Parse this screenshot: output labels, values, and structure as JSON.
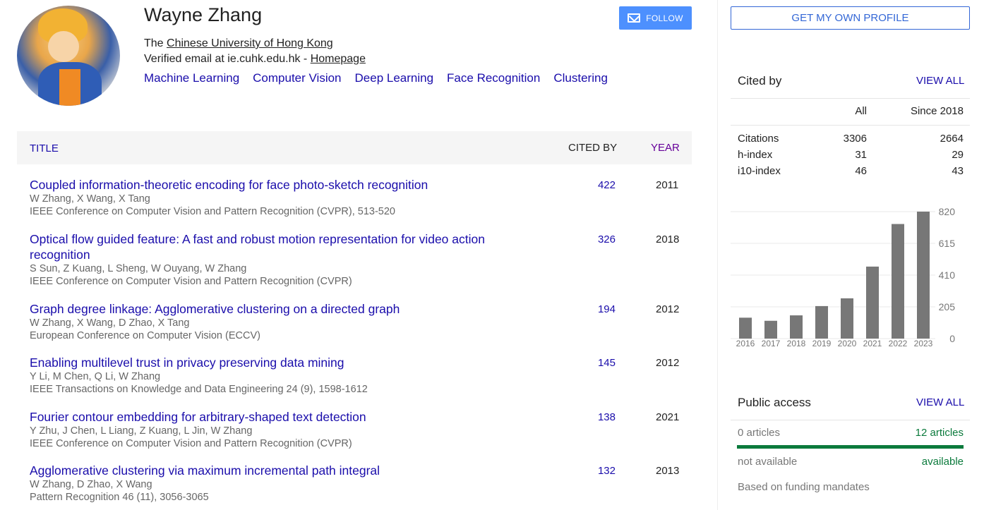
{
  "profile": {
    "name": "Wayne Zhang",
    "affil_prefix": "The ",
    "affil_link": "Chinese University of Hong Kong",
    "email_text": "Verified email at ie.cuhk.edu.hk - ",
    "homepage_link": "Homepage",
    "interests": [
      "Machine Learning",
      "Computer Vision",
      "Deep Learning",
      "Face Recognition",
      "Clustering"
    ],
    "follow_label": "FOLLOW"
  },
  "table": {
    "headers": {
      "title": "TITLE",
      "cited_by": "CITED BY",
      "year": "YEAR"
    },
    "rows": [
      {
        "title": "Coupled information-theoretic encoding for face photo-sketch recognition",
        "authors": "W Zhang, X Wang, X Tang",
        "venue": "IEEE Conference on Computer Vision and Pattern Recognition (CVPR), 513-520",
        "cites": "422",
        "year": "2011"
      },
      {
        "title": "Optical flow guided feature: A fast and robust motion representation for video action recognition",
        "authors": "S Sun, Z Kuang, L Sheng, W Ouyang, W Zhang",
        "venue": "IEEE Conference on Computer Vision and Pattern Recognition (CVPR)",
        "cites": "326",
        "year": "2018"
      },
      {
        "title": "Graph degree linkage: Agglomerative clustering on a directed graph",
        "authors": "W Zhang, X Wang, D Zhao, X Tang",
        "venue": "European Conference on Computer Vision (ECCV)",
        "cites": "194",
        "year": "2012"
      },
      {
        "title": "Enabling multilevel trust in privacy preserving data mining",
        "authors": "Y Li, M Chen, Q Li, W Zhang",
        "venue": "IEEE Transactions on Knowledge and Data Engineering 24 (9), 1598-1612",
        "cites": "145",
        "year": "2012"
      },
      {
        "title": "Fourier contour embedding for arbitrary-shaped text detection",
        "authors": "Y Zhu, J Chen, L Liang, Z Kuang, L Jin, W Zhang",
        "venue": "IEEE Conference on Computer Vision and Pattern Recognition (CVPR)",
        "cites": "138",
        "year": "2021"
      },
      {
        "title": "Agglomerative clustering via maximum incremental path integral",
        "authors": "W Zhang, D Zhao, X Wang",
        "venue": "Pattern Recognition 46 (11), 3056-3065",
        "cites": "132",
        "year": "2013"
      }
    ]
  },
  "sidebar": {
    "own_profile_label": "GET MY OWN PROFILE",
    "cited_by": {
      "heading": "Cited by",
      "view_all": "VIEW ALL",
      "col_all": "All",
      "col_since": "Since 2018",
      "rows": [
        {
          "label": "Citations",
          "all": "3306",
          "since": "2664"
        },
        {
          "label": "h-index",
          "all": "31",
          "since": "29"
        },
        {
          "label": "i10-index",
          "all": "46",
          "since": "43"
        }
      ]
    },
    "public_access": {
      "heading": "Public access",
      "view_all": "VIEW ALL",
      "left_count": "0 articles",
      "right_count": "12 articles",
      "left_status": "not available",
      "right_status": "available",
      "note": "Based on funding mandates",
      "available_fraction": 1.0
    }
  },
  "colors": {
    "link": "#1a0dab",
    "button": "#4d90fe",
    "bar": "#777777",
    "available": "#0b7a3c"
  },
  "chart_data": {
    "type": "bar",
    "categories": [
      "2016",
      "2017",
      "2018",
      "2019",
      "2020",
      "2021",
      "2022",
      "2023"
    ],
    "values": [
      135,
      115,
      150,
      210,
      260,
      465,
      740,
      820
    ],
    "yticks": [
      "0",
      "205",
      "410",
      "615",
      "820"
    ],
    "ylim": [
      0,
      820
    ],
    "grid": true
  }
}
